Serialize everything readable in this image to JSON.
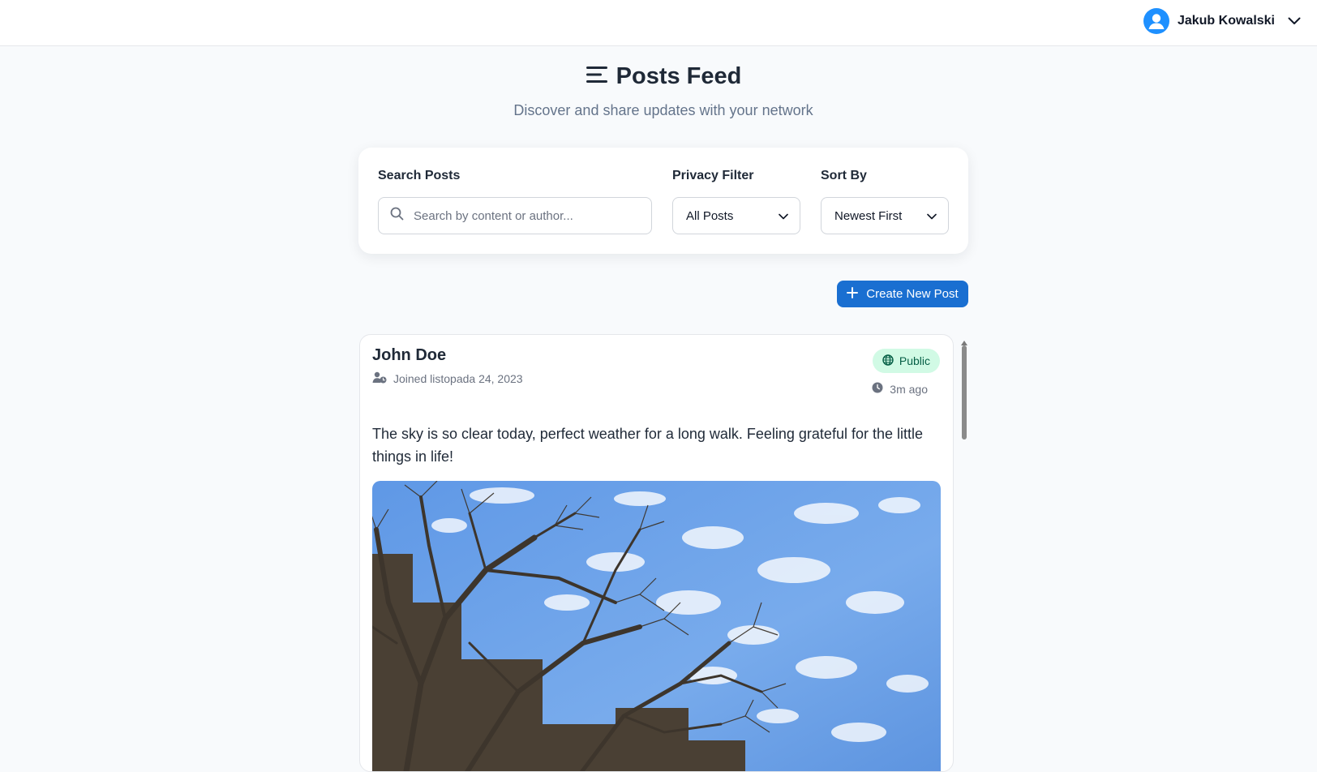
{
  "header": {
    "user_name": "Jakub Kowalski",
    "avatar_icon": "user-circle-icon",
    "menu_icon": "chevron-down-icon"
  },
  "page": {
    "title": "Posts Feed",
    "title_icon": "menu-lines-icon",
    "subtitle": "Discover and share updates with your network"
  },
  "filters": {
    "search_label": "Search Posts",
    "search_placeholder": "Search by content or author...",
    "privacy_label": "Privacy Filter",
    "privacy_value": "All Posts",
    "sort_label": "Sort By",
    "sort_value": "Newest First"
  },
  "actions": {
    "create_label": "Create New Post"
  },
  "posts": [
    {
      "author": "John Doe",
      "joined": "Joined listopada 24, 2023",
      "privacy": "Public",
      "time": "3m ago",
      "content": "The sky is so clear today, perfect weather for a long walk. Feeling grateful for the little things in life!",
      "image_alt": "Bare trees against a blue sky with scattered clouds"
    }
  ],
  "colors": {
    "accent": "#1a6fd1",
    "avatar": "#1e90ff",
    "badge_bg": "#d1fae5",
    "badge_text": "#065f46",
    "page_bg": "#f8fafc"
  }
}
